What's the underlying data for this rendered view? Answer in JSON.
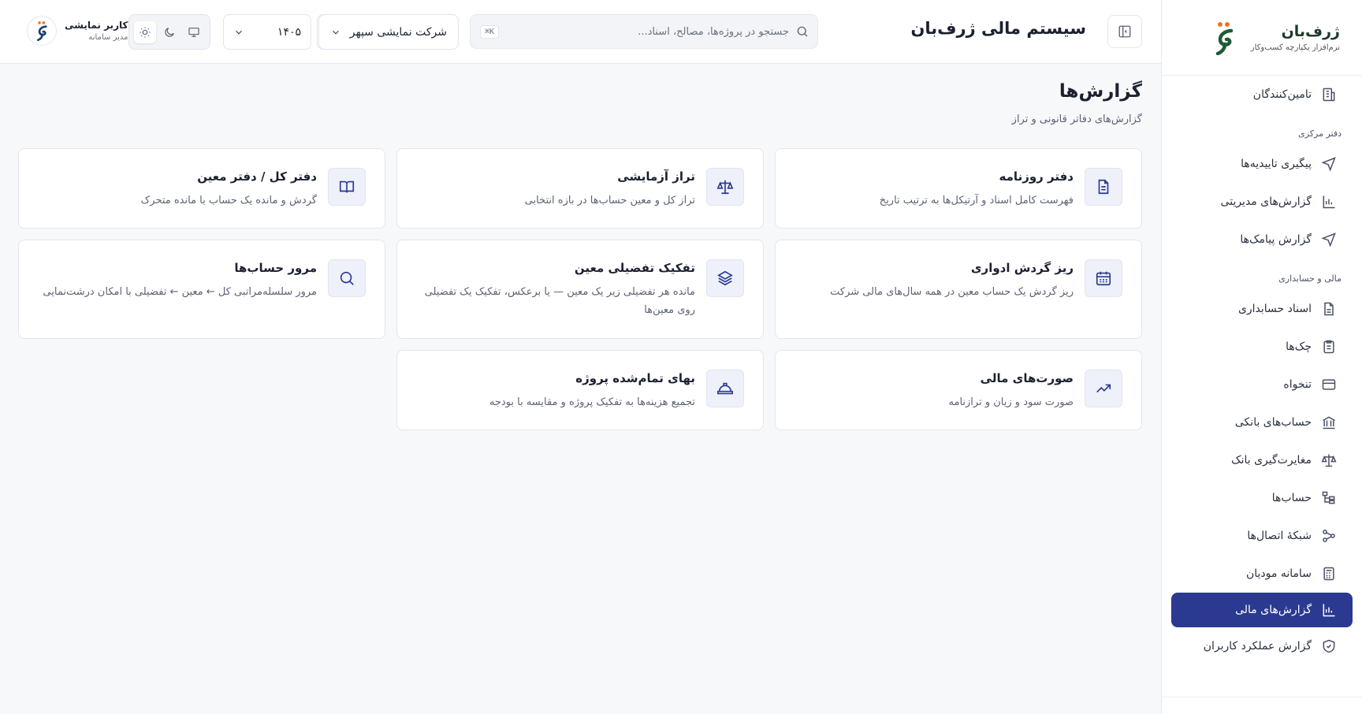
{
  "sidebar": {
    "brand_name": "ژرف‌بان",
    "brand_tagline": "نرم‌افزار یکپارچه کسب‌وکار",
    "items": [
      {
        "label": "تامین‌کنندگان",
        "icon": "building-icon"
      },
      {
        "section": "دفتر مرکزی"
      },
      {
        "label": "پیگیری تاییدیه‌ها",
        "icon": "send-icon"
      },
      {
        "label": "گزارش‌های مدیریتی",
        "icon": "bar-chart-icon"
      },
      {
        "label": "گزارش پیامک‌ها",
        "icon": "send-icon"
      },
      {
        "section": "مالی و حسابداری"
      },
      {
        "label": "اسناد حسابداری",
        "icon": "document-icon"
      },
      {
        "label": "چک‌ها",
        "icon": "clipboard-icon"
      },
      {
        "label": "تنخواه",
        "icon": "wallet-icon"
      },
      {
        "label": "حساب‌های بانکی",
        "icon": "bank-icon"
      },
      {
        "label": "مغایرت‌گیری بانک",
        "icon": "scale-icon"
      },
      {
        "label": "حساب‌ها",
        "icon": "tree-icon"
      },
      {
        "label": "شبکهٔ اتصال‌ها",
        "icon": "network-icon"
      },
      {
        "label": "سامانه مودیان",
        "icon": "calculator-icon"
      },
      {
        "label": "گزارش‌های مالی",
        "icon": "bar-chart-icon",
        "active": true
      },
      {
        "label": "گزارش عملکرد کاربران",
        "icon": "shield-icon"
      }
    ]
  },
  "header": {
    "title": "سیستم مالی ژرف‌بان",
    "search_placeholder": "جستجو در پروژه‌ها، مصالح، اسناد...",
    "search_shortcut": "K⌘",
    "company": "شرکت نمایشی سپهر",
    "year": "۱۴۰۵",
    "user_name": "کاربر نمایشی",
    "user_role": "مدیر سامانه"
  },
  "main": {
    "title": "گزارش‌ها",
    "subtitle": "گزارش‌های دفاتر قانونی و تراز",
    "cards": [
      {
        "title": "دفتر روزنامه",
        "desc": "فهرست کامل اسناد و آرتیکل‌ها به ترتیب تاریخ",
        "icon": "document-icon"
      },
      {
        "title": "تراز آزمایشی",
        "desc": "تراز کل و معین حساب‌ها در بازه انتخابی",
        "icon": "scale-icon"
      },
      {
        "title": "دفتر کل / دفتر معین",
        "desc": "گردش و مانده یک حساب با مانده متحرک",
        "icon": "book-icon"
      },
      {
        "title": "ریز گردش ادواری",
        "desc": "ریز گردش یک حساب معین در همه سال‌های مالی شرکت",
        "icon": "calendar-icon"
      },
      {
        "title": "تفکیک تفضیلی معین",
        "desc": "مانده هر تفضیلی زیر یک معین — یا برعکس، تفکیک یک تفضیلی روی معین‌ها",
        "icon": "layers-icon"
      },
      {
        "title": "مرور حساب‌ها",
        "desc": "مرور سلسله‌مراتبی کل ← معین ← تفضیلی با امکان درشت‌نمایی",
        "icon": "search-icon"
      },
      {
        "title": "صورت‌های مالی",
        "desc": "صورت سود و زیان و ترازنامه",
        "icon": "trending-up-icon"
      },
      {
        "title": "بهای تمام‌شده پروژه",
        "desc": "تجمیع هزینه‌ها به تفکیک پروژه و مقایسه با بودجه",
        "icon": "hardhat-icon"
      }
    ]
  }
}
